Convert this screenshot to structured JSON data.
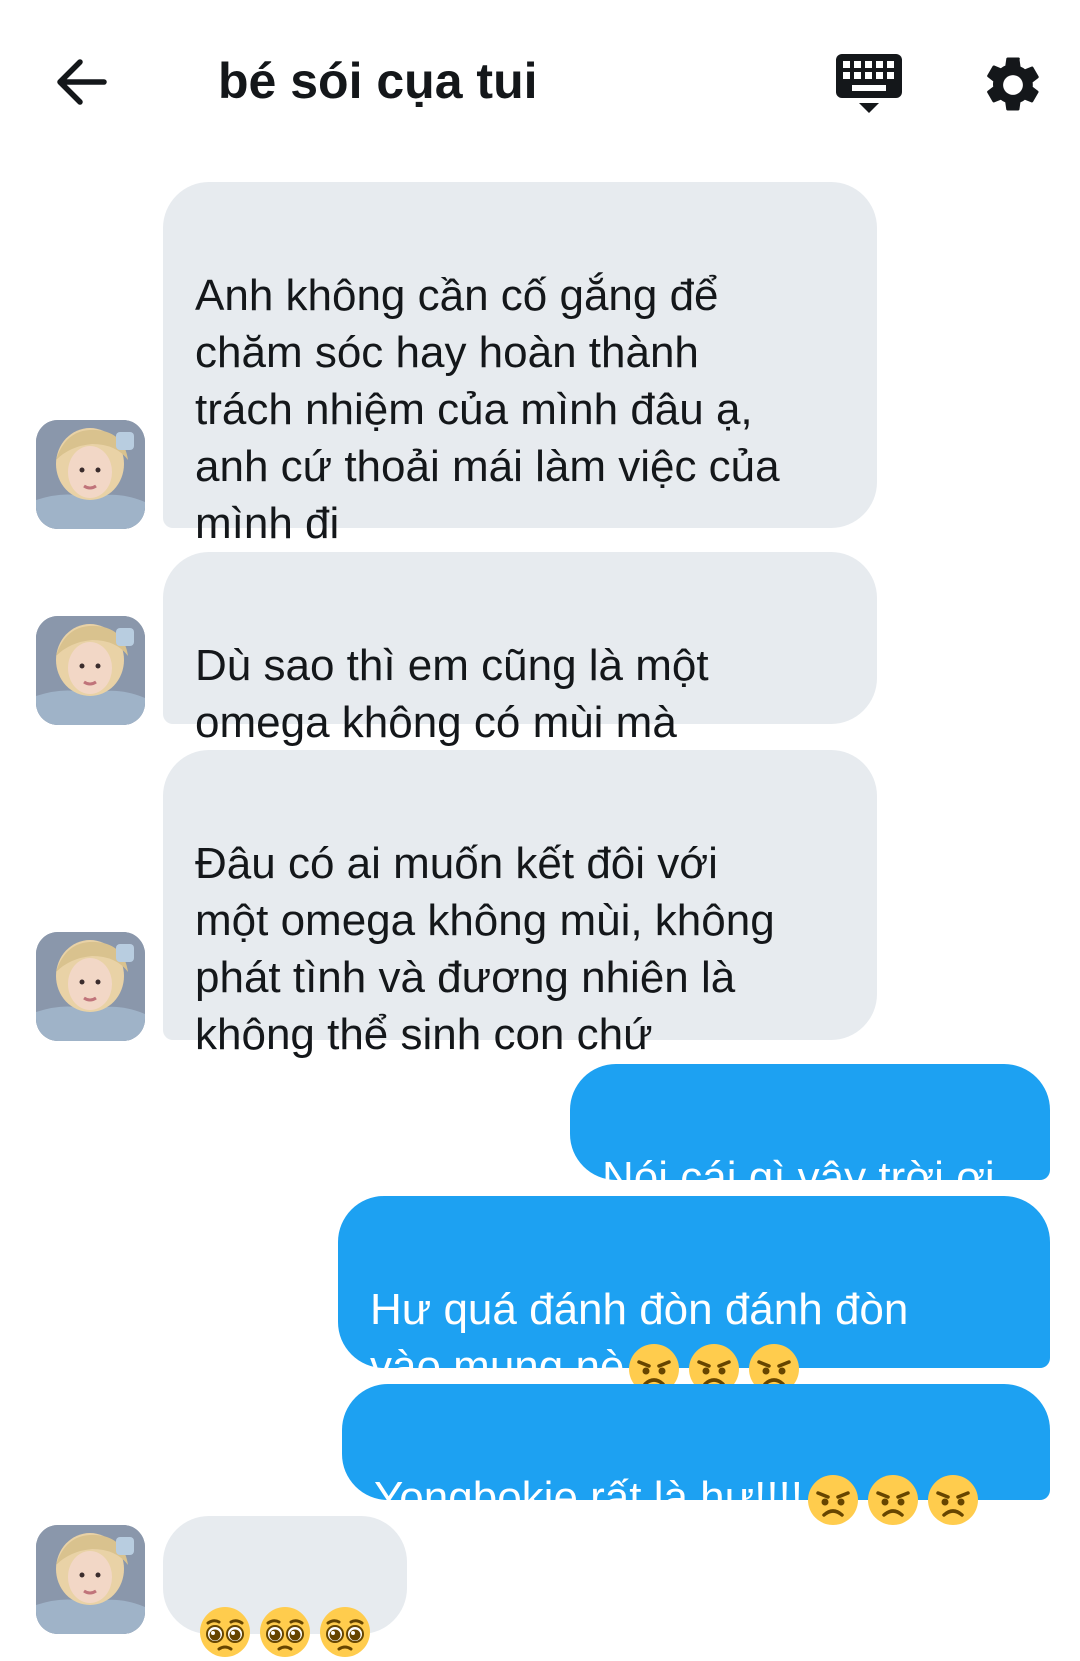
{
  "header": {
    "title": "bé sói cụa tui",
    "back_icon": "arrow-left-icon",
    "keyboard_icon": "keyboard-icon",
    "settings_icon": "gear-icon"
  },
  "messages": [
    {
      "from": "them",
      "text": "Anh không cần cố gắng để\nchăm sóc hay hoàn thành\ntrách nhiệm của mình đâu ạ,\nanh cứ thoải mái làm việc của\nmình đi"
    },
    {
      "from": "them",
      "text": "Dù sao thì em cũng là một\nomega không có mùi mà"
    },
    {
      "from": "them",
      "text": "Đâu có ai muốn kết đôi với\nmột omega không mùi, không\nphát tình và đương nhiên là\nkhông thể sinh con chứ"
    },
    {
      "from": "me",
      "text": "Nói cái gì vậy trời ơi"
    },
    {
      "from": "me",
      "text": "Hư quá đánh đòn đánh đòn\nvào mung nè",
      "emoji": [
        "angry-face-icon",
        "angry-face-icon",
        "angry-face-icon"
      ]
    },
    {
      "from": "me",
      "text": "Yongbokie rất là hư!!!!",
      "emoji": [
        "angry-face-icon",
        "angry-face-icon",
        "angry-face-icon"
      ]
    },
    {
      "from": "them",
      "text": "",
      "emoji": [
        "pleading-face-icon",
        "pleading-face-icon",
        "pleading-face-icon"
      ]
    }
  ],
  "colors": {
    "incoming_bubble": "#e7ebef",
    "outgoing_bubble": "#1da1f2",
    "text_dark": "#14171a"
  }
}
